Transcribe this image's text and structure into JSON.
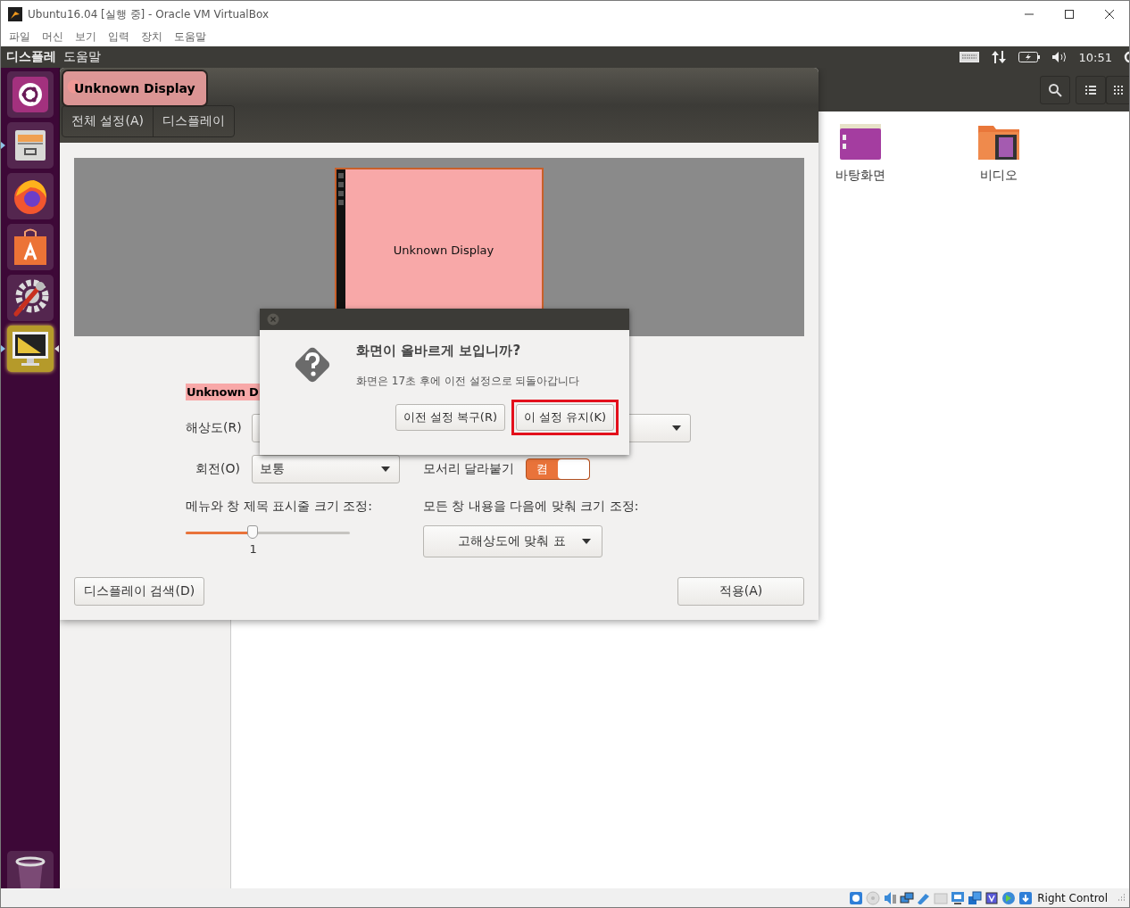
{
  "window": {
    "title": "Ubuntu16.04 [실행 중] - Oracle VM VirtualBox"
  },
  "menu": [
    "파일",
    "머신",
    "보기",
    "입력",
    "장치",
    "도움말"
  ],
  "top_panel": {
    "app_name": "디스플레",
    "menu": "도움말",
    "time": "10:51"
  },
  "launcher": [
    {
      "kind": "dash",
      "running": false,
      "selected": false
    },
    {
      "kind": "files",
      "running": true,
      "selected": false
    },
    {
      "kind": "browser",
      "running": false,
      "selected": false
    },
    {
      "kind": "software",
      "running": false,
      "selected": false
    },
    {
      "kind": "settings",
      "running": false,
      "selected": false
    },
    {
      "kind": "display",
      "running": true,
      "selected": true
    },
    {
      "kind": "trash",
      "running": false,
      "selected": false
    }
  ],
  "file_manager": {
    "items": [
      {
        "label": "바탕화면",
        "kind": "desktop"
      },
      {
        "label": "비디오",
        "kind": "videos"
      }
    ]
  },
  "settings_window": {
    "tooltip": "Unknown Display",
    "nav": [
      "전체 설정(A)",
      "디스플레이"
    ],
    "monitor": {
      "label": "Unknown Display"
    },
    "display_name": "Unknown D",
    "resolution_label": "해상도(R)",
    "rotation_label": "회전(O)",
    "rotation_value": "보통",
    "sticky_edges_label": "모서리 달라붙기",
    "sticky_edges": {
      "on": true,
      "text": "켬"
    },
    "scale_label": "메뉴와 창 제목 표시줄 크기 조정:",
    "scale": {
      "level": 0.41,
      "reading": "1"
    },
    "fit_label": "모든 창 내용을 다음에 맞춰 크기 조정:",
    "fit_value": "고해상도에 맞춰 표",
    "detect_button": "디스플레이 검색(D)",
    "apply_button": "적용(A)"
  },
  "dialog": {
    "title": "화면이 올바르게 보입니까?",
    "message": "화면은 17초 후에 이전 설정으로 되돌아갑니다",
    "buttons": [
      {
        "label": "이전 설정 복구(R)",
        "highlighted": false
      },
      {
        "label": "이 설정 유지(K)",
        "highlighted": true
      }
    ]
  },
  "status_bar": {
    "host_key": "Right Control"
  }
}
